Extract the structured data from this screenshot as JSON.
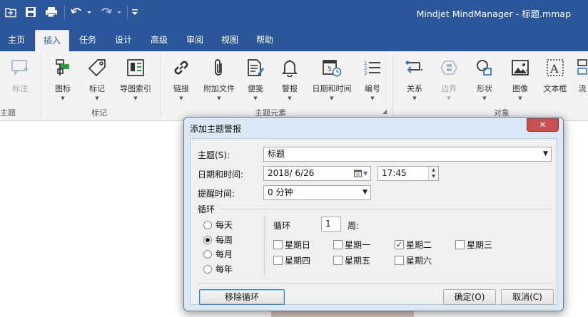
{
  "window": {
    "title": "Mindjet MindManager - 标题.mmap"
  },
  "quick_access": {
    "icons": [
      "open-icon",
      "save-icon",
      "print-icon",
      "undo-icon",
      "redo-icon",
      "customize-icon"
    ]
  },
  "tabs": [
    {
      "label": "主页"
    },
    {
      "label": "插入",
      "active": true
    },
    {
      "label": "任务"
    },
    {
      "label": "设计"
    },
    {
      "label": "高级"
    },
    {
      "label": "审阅"
    },
    {
      "label": "视图"
    },
    {
      "label": "帮助"
    }
  ],
  "ribbon": {
    "buttons": {
      "callout": "标注",
      "icons": "图标",
      "tags": "标记",
      "map_index": "导图索引",
      "link": "链接",
      "attach": "附加文件",
      "notes": "便笺",
      "alert": "警报",
      "datetime": "日期和时间",
      "numbering": "编号",
      "relation": "关系",
      "boundary": "边界",
      "shape": "形状",
      "image": "图像",
      "textbox": "文本框",
      "partial": "流"
    },
    "groups": {
      "topic_partial": "主题",
      "tags": "标记",
      "topic_elements": "主题元素",
      "objects": "对象"
    }
  },
  "dialog": {
    "title": "添加主题警报",
    "close": "✕",
    "topic_label": "主题(S):",
    "topic_value": "标题",
    "datetime_label": "日期和时间:",
    "date_value": "2018/  6/26",
    "time_value": "17:45",
    "reminder_label": "提醒时间:",
    "reminder_value": "0 分钟",
    "recurrence_label": "循环",
    "frequency": [
      {
        "label": "每天",
        "selected": false
      },
      {
        "label": "每周",
        "selected": true
      },
      {
        "label": "每月",
        "selected": false
      },
      {
        "label": "每年",
        "selected": false
      }
    ],
    "repeat_label": "循环",
    "repeat_count": "1",
    "repeat_unit": "周:",
    "weekdays": [
      {
        "label": "星期日",
        "checked": false
      },
      {
        "label": "星期一",
        "checked": false
      },
      {
        "label": "星期二",
        "checked": true
      },
      {
        "label": "星期三",
        "checked": false
      },
      {
        "label": "星期四",
        "checked": false
      },
      {
        "label": "星期五",
        "checked": false
      },
      {
        "label": "星期六",
        "checked": false
      }
    ],
    "remove_button": "移除循环",
    "ok_button": "确定(O)",
    "cancel_button": "取消(C)"
  }
}
